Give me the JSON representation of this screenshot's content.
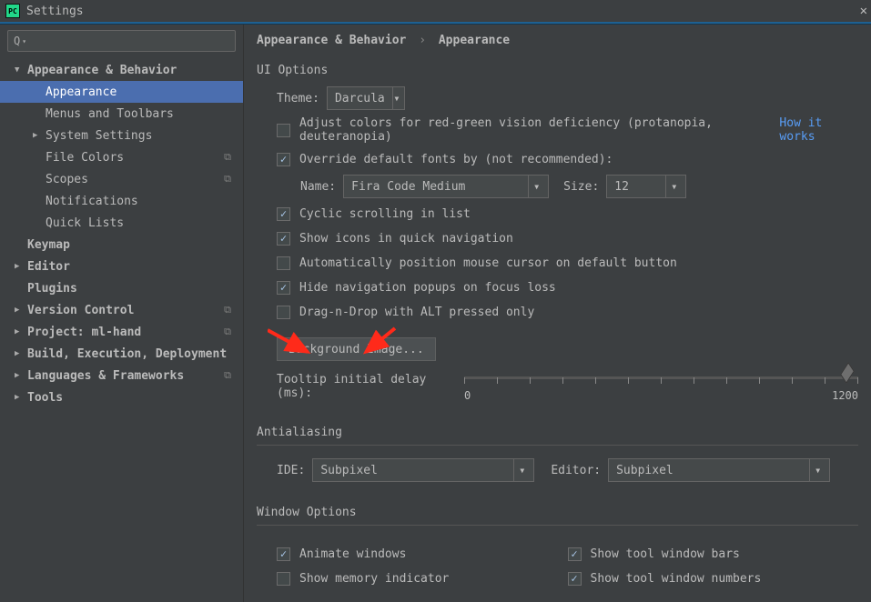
{
  "window": {
    "title": "Settings"
  },
  "sidebar": {
    "items": [
      {
        "label": "Appearance & Behavior",
        "bold": true,
        "exp": "▼",
        "depth": 0
      },
      {
        "label": "Appearance",
        "depth": "1nx",
        "selected": true
      },
      {
        "label": "Menus and Toolbars",
        "depth": "1nx"
      },
      {
        "label": "System Settings",
        "exp": "▶",
        "depth": 1
      },
      {
        "label": "File Colors",
        "depth": "1nx",
        "badge": "⧉"
      },
      {
        "label": "Scopes",
        "depth": "1nx",
        "badge": "⧉"
      },
      {
        "label": "Notifications",
        "depth": "1nx"
      },
      {
        "label": "Quick Lists",
        "depth": "1nx"
      },
      {
        "label": "Keymap",
        "bold": true,
        "depth": 0,
        "exp": ""
      },
      {
        "label": "Editor",
        "bold": true,
        "exp": "▶",
        "depth": 0
      },
      {
        "label": "Plugins",
        "bold": true,
        "depth": 0,
        "exp": ""
      },
      {
        "label": "Version Control",
        "bold": true,
        "exp": "▶",
        "depth": 0,
        "badge": "⧉"
      },
      {
        "label": "Project: ml-hand",
        "bold": true,
        "exp": "▶",
        "depth": 0,
        "badge": "⧉"
      },
      {
        "label": "Build, Execution, Deployment",
        "bold": true,
        "exp": "▶",
        "depth": 0
      },
      {
        "label": "Languages & Frameworks",
        "bold": true,
        "exp": "▶",
        "depth": 0,
        "badge": "⧉"
      },
      {
        "label": "Tools",
        "bold": true,
        "exp": "▶",
        "depth": 0
      }
    ]
  },
  "breadcrumb": {
    "a": "Appearance & Behavior",
    "b": "Appearance"
  },
  "ui": {
    "section": "UI Options",
    "theme_label": "Theme:",
    "theme_value": "Darcula",
    "adjust": "Adjust colors for red-green vision deficiency (protanopia, deuteranopia)",
    "howitworks": "How it works",
    "override": "Override default fonts by (not recommended):",
    "font_name_label": "Name:",
    "font_name_value": "Fira Code Medium",
    "font_size_label": "Size:",
    "font_size_value": "12",
    "cyclic": "Cyclic scrolling in list",
    "icons_quick": "Show icons in quick navigation",
    "auto_mouse": "Automatically position mouse cursor on default button",
    "hide_nav": "Hide navigation popups on focus loss",
    "dnd_alt": "Drag-n-Drop with ALT pressed only",
    "bg_btn": "Background Image...",
    "tooltip_label": "Tooltip initial delay (ms):",
    "slider_min": "0",
    "slider_max": "1200"
  },
  "aa": {
    "section": "Antialiasing",
    "ide_label": "IDE:",
    "ide_value": "Subpixel",
    "editor_label": "Editor:",
    "editor_value": "Subpixel"
  },
  "win": {
    "section": "Window Options",
    "animate": "Animate windows",
    "memory": "Show memory indicator",
    "bars": "Show tool window bars",
    "numbers": "Show tool window numbers"
  }
}
